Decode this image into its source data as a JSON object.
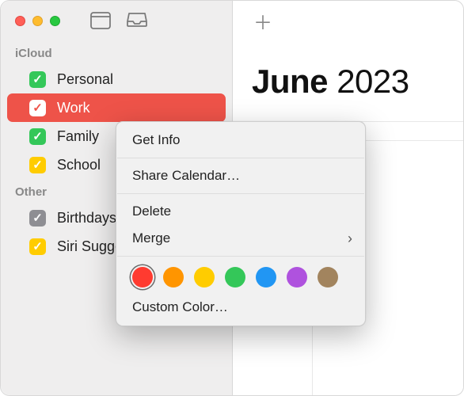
{
  "sidebar": {
    "sections": [
      {
        "label": "iCloud",
        "items": [
          {
            "label": "Personal",
            "color": "#34c759",
            "selected": false
          },
          {
            "label": "Work",
            "color": "#ee5349",
            "selected": true
          },
          {
            "label": "Family",
            "color": "#34c759",
            "selected": false
          },
          {
            "label": "School",
            "color": "#ffcc00",
            "selected": false
          }
        ]
      },
      {
        "label": "Other",
        "items": [
          {
            "label": "Birthdays",
            "color": "#8e8e93",
            "selected": false
          },
          {
            "label": "Siri Suggestions",
            "color": "#ffcc00",
            "selected": false
          }
        ]
      }
    ]
  },
  "main": {
    "month": "June",
    "year": "2023"
  },
  "context_menu": {
    "get_info": "Get Info",
    "share": "Share Calendar…",
    "delete": "Delete",
    "merge": "Merge",
    "custom_color": "Custom Color…",
    "colors": [
      {
        "hex": "#ff3b30",
        "selected": true
      },
      {
        "hex": "#ff9500",
        "selected": false
      },
      {
        "hex": "#ffcc00",
        "selected": false
      },
      {
        "hex": "#34c759",
        "selected": false
      },
      {
        "hex": "#2196f3",
        "selected": false
      },
      {
        "hex": "#af52de",
        "selected": false
      },
      {
        "hex": "#a2845e",
        "selected": false
      }
    ]
  }
}
